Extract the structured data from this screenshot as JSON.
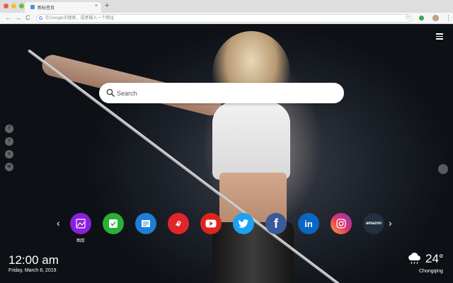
{
  "browser": {
    "tab_title": "新标签页",
    "tab_close": "×",
    "new_tab": "+",
    "omnibox_placeholder": "在Google中搜索，或者输入一个网址",
    "back": "←",
    "forward": "→",
    "reload": "C",
    "google_mark": "G",
    "bookmark_icon": "star-icon",
    "menu_icon": "⋮"
  },
  "search": {
    "placeholder": "Search"
  },
  "side_social": [
    {
      "name": "facebook",
      "glyph": "f"
    },
    {
      "name": "twitter",
      "glyph": "t"
    },
    {
      "name": "snapchat",
      "glyph": "s"
    },
    {
      "name": "wechat",
      "glyph": "w"
    }
  ],
  "apps": [
    {
      "name": "gallery",
      "label": "图库",
      "color": "#8a1fe0"
    },
    {
      "name": "tasks",
      "label": "",
      "color": "#29b036"
    },
    {
      "name": "notes",
      "label": "",
      "color": "#1f7ed6"
    },
    {
      "name": "games",
      "label": "",
      "color": "#e1262a"
    },
    {
      "name": "youtube",
      "label": "",
      "color": "#e0231b"
    },
    {
      "name": "twitter",
      "label": "",
      "color": "#1da1f2"
    },
    {
      "name": "facebook",
      "label": "",
      "color": "#3a5a99"
    },
    {
      "name": "linkedin",
      "label": "",
      "color": "#0a66c2"
    },
    {
      "name": "instagram",
      "label": "",
      "color": "#c13584"
    },
    {
      "name": "amazon",
      "label": "",
      "text": "amazon",
      "color": "#232f3e"
    }
  ],
  "arrows": {
    "prev": "‹",
    "next": "›"
  },
  "clock": {
    "time": "12:00 am",
    "date": "Friday, March 8, 2019"
  },
  "weather": {
    "temp": "24°",
    "city": "Chongqing",
    "icon": "cloud-rain-icon"
  }
}
